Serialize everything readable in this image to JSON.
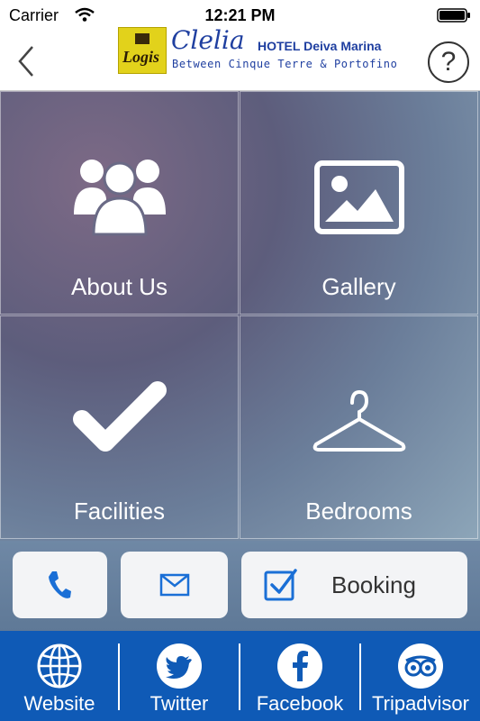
{
  "status_bar": {
    "carrier": "Carrier",
    "time": "12:21 PM"
  },
  "header": {
    "logo_text": "Logis",
    "brand_name": "Clelia",
    "brand_hotel": "HOTEL Deiva Marina",
    "brand_subtitle": "Between Cinque Terre & Portofino",
    "help_symbol": "?"
  },
  "tiles": [
    {
      "label": "About Us",
      "icon": "group-icon"
    },
    {
      "label": "Gallery",
      "icon": "image-icon"
    },
    {
      "label": "Facilities",
      "icon": "checkmark-icon"
    },
    {
      "label": "Bedrooms",
      "icon": "hanger-icon"
    }
  ],
  "actions": {
    "phone_icon": "phone-icon",
    "mail_icon": "mail-icon",
    "booking_label": "Booking",
    "booking_icon": "checkbox-icon"
  },
  "footer": {
    "items": [
      {
        "label": "Website",
        "icon": "globe-icon"
      },
      {
        "label": "Twitter",
        "icon": "twitter-icon"
      },
      {
        "label": "Facebook",
        "icon": "facebook-icon"
      },
      {
        "label": "Tripadvisor",
        "icon": "tripadvisor-icon"
      }
    ]
  },
  "colors": {
    "footer_bg": "#0f5ab6",
    "accent_blue": "#1a6fd6",
    "brand_blue": "#1f3fa0",
    "logo_yellow": "#e2d21b"
  }
}
